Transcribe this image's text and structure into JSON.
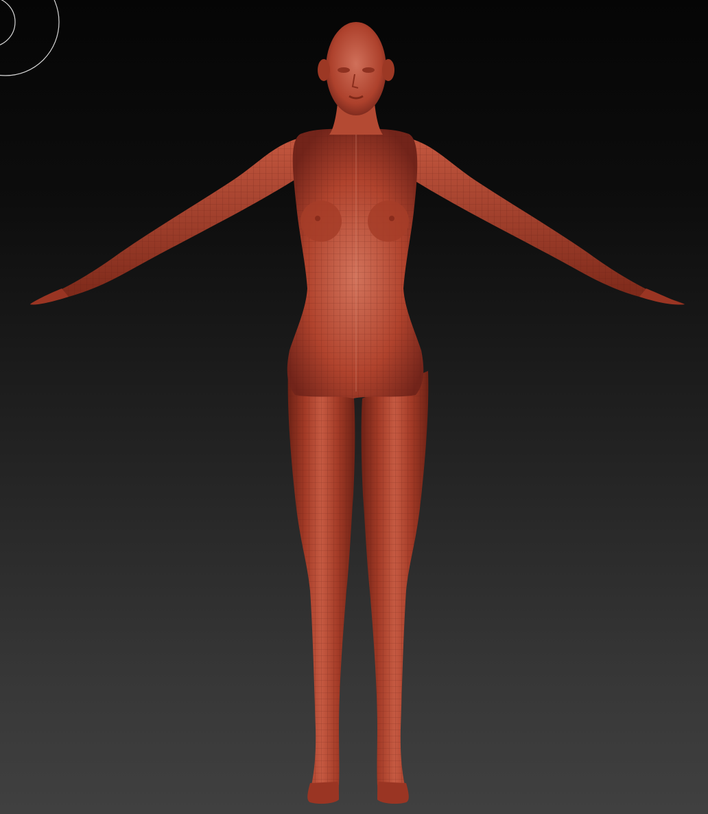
{
  "viewport": {
    "background_top": "#050505",
    "background_bottom": "#404040"
  },
  "model": {
    "name": "female-base-mesh",
    "material_color": "#b4432e",
    "material_highlight": "#d8775e",
    "material_shadow": "#6e2216",
    "pose": "a-pose",
    "show_polyframe": true
  },
  "brush_cursor": {
    "icon": "brush-circle-icon",
    "color": "#d9d9d9"
  }
}
